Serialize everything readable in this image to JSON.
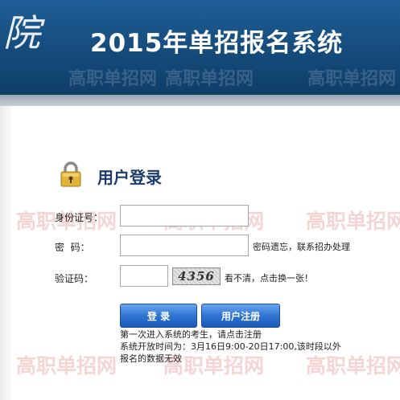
{
  "header": {
    "logo_glyph": "院",
    "title": "2015年单招报名系统",
    "watermark": "高职单招网"
  },
  "login": {
    "title": "用户登录",
    "id_label": "身份证号：",
    "id_value": "",
    "password_label": "密  码：",
    "password_hint": "密码遗忘，联系招办处理",
    "captcha_label": "验证码：",
    "captcha_value": "",
    "captcha_text": "4356",
    "captcha_refresh": "看不清，点击换一张！",
    "login_button": "登 录",
    "register_button": "用户注册",
    "note_line1": "第一次进入系统的考生，请点击注册",
    "note_line2": "系统开放时间为：3月16日9:00-20日17:00,该时段以外",
    "note_line3": "报名的数据无效"
  },
  "colors": {
    "header_bg": "#154b7b",
    "title_text": "#1b3c6b",
    "button_bg": "#2f73d1",
    "watermark": "#d23c3c"
  },
  "icons": {
    "lock": "padlock-icon"
  }
}
